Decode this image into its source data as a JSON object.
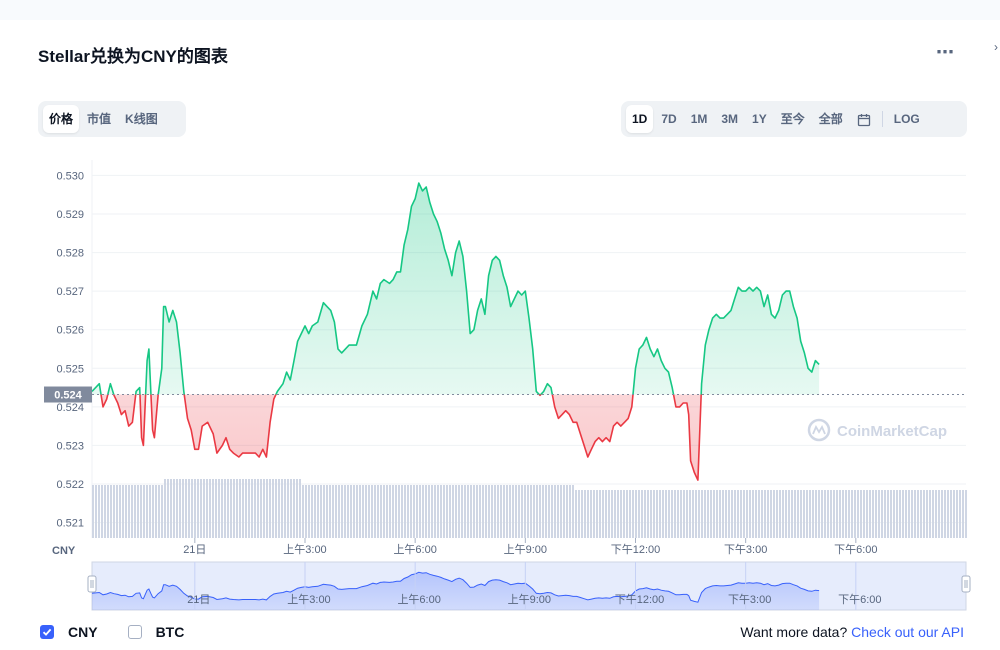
{
  "title": "Stellar兑换为CNY的图表",
  "more_icon": "⋯",
  "view_tabs": [
    "价格",
    "市值",
    "K线图"
  ],
  "active_view": 0,
  "range_tabs": [
    "1D",
    "7D",
    "1M",
    "3M",
    "1Y",
    "至今",
    "全部"
  ],
  "active_range": 0,
  "calendar_icon": "calendar-icon",
  "log_label": "LOG",
  "legend": {
    "cny_label": "CNY",
    "btc_label": "BTC",
    "cny_checked": true,
    "btc_checked": false
  },
  "api_text": "Want more data?",
  "api_link": "Check out our API",
  "watermark": "CoinMarketCap",
  "colors": {
    "up": "#16c784",
    "down": "#ea3943",
    "accent": "#3861fb",
    "volume": "#cfd6e4"
  },
  "chart_data": {
    "type": "area",
    "currency_label": "CNY",
    "baseline": 0.52432,
    "baseline_label": "0.524",
    "y_ticks": [
      "0.530",
      "0.529",
      "0.528",
      "0.527",
      "0.526",
      "0.525",
      "0.524",
      "0.523",
      "0.522",
      "0.521"
    ],
    "ylim": [
      0.5206,
      0.5304
    ],
    "x_ticks": [
      "21日",
      "上午3:00",
      "上午6:00",
      "上午9:00",
      "下午12:00",
      "下午3:00",
      "下午6:00"
    ],
    "x_tick_hours": [
      0,
      3,
      6,
      9,
      12,
      15,
      18
    ],
    "xlim": [
      -2.8,
      21.0
    ],
    "series": [
      {
        "values": [
          [
            -2.8,
            0.5244
          ],
          [
            -2.6,
            0.5246
          ],
          [
            -2.5,
            0.524
          ],
          [
            -2.4,
            0.5242
          ],
          [
            -2.3,
            0.5246
          ],
          [
            -2.2,
            0.5243
          ],
          [
            -2.1,
            0.5241
          ],
          [
            -2.0,
            0.5238
          ],
          [
            -1.9,
            0.5239
          ],
          [
            -1.8,
            0.5235
          ],
          [
            -1.7,
            0.5236
          ],
          [
            -1.6,
            0.5244
          ],
          [
            -1.5,
            0.5245
          ],
          [
            -1.45,
            0.5232
          ],
          [
            -1.4,
            0.523
          ],
          [
            -1.3,
            0.5252
          ],
          [
            -1.25,
            0.5255
          ],
          [
            -1.2,
            0.5244
          ],
          [
            -1.15,
            0.5234
          ],
          [
            -1.1,
            0.5232
          ],
          [
            -1.0,
            0.5243
          ],
          [
            -0.9,
            0.525
          ],
          [
            -0.85,
            0.5266
          ],
          [
            -0.8,
            0.5266
          ],
          [
            -0.7,
            0.5262
          ],
          [
            -0.6,
            0.5265
          ],
          [
            -0.5,
            0.5262
          ],
          [
            -0.4,
            0.5254
          ],
          [
            -0.3,
            0.5244
          ],
          [
            -0.2,
            0.5237
          ],
          [
            -0.1,
            0.5234
          ],
          [
            0.0,
            0.5229
          ],
          [
            0.1,
            0.5229
          ],
          [
            0.2,
            0.5235
          ],
          [
            0.35,
            0.5236
          ],
          [
            0.5,
            0.5233
          ],
          [
            0.6,
            0.5228
          ],
          [
            0.75,
            0.523
          ],
          [
            0.85,
            0.5232
          ],
          [
            0.95,
            0.5229
          ],
          [
            1.05,
            0.5228
          ],
          [
            1.2,
            0.5227
          ],
          [
            1.3,
            0.5228
          ],
          [
            1.5,
            0.5228
          ],
          [
            1.65,
            0.5228
          ],
          [
            1.75,
            0.5227
          ],
          [
            1.85,
            0.5229
          ],
          [
            1.95,
            0.5227
          ],
          [
            2.05,
            0.5236
          ],
          [
            2.15,
            0.5242
          ],
          [
            2.25,
            0.5244
          ],
          [
            2.4,
            0.5246
          ],
          [
            2.5,
            0.5249
          ],
          [
            2.6,
            0.5247
          ],
          [
            2.7,
            0.5252
          ],
          [
            2.8,
            0.5257
          ],
          [
            2.9,
            0.5259
          ],
          [
            3.0,
            0.5261
          ],
          [
            3.1,
            0.5259
          ],
          [
            3.2,
            0.5261
          ],
          [
            3.35,
            0.5262
          ],
          [
            3.5,
            0.5267
          ],
          [
            3.6,
            0.5266
          ],
          [
            3.7,
            0.5265
          ],
          [
            3.8,
            0.5262
          ],
          [
            3.9,
            0.5255
          ],
          [
            4.0,
            0.5254
          ],
          [
            4.2,
            0.5256
          ],
          [
            4.4,
            0.5256
          ],
          [
            4.55,
            0.5261
          ],
          [
            4.7,
            0.5264
          ],
          [
            4.85,
            0.527
          ],
          [
            4.95,
            0.5268
          ],
          [
            5.05,
            0.5272
          ],
          [
            5.15,
            0.5273
          ],
          [
            5.3,
            0.5272
          ],
          [
            5.4,
            0.5273
          ],
          [
            5.5,
            0.5275
          ],
          [
            5.6,
            0.5275
          ],
          [
            5.7,
            0.5282
          ],
          [
            5.8,
            0.5286
          ],
          [
            5.9,
            0.5292
          ],
          [
            6.0,
            0.5294
          ],
          [
            6.1,
            0.5298
          ],
          [
            6.2,
            0.5296
          ],
          [
            6.3,
            0.5297
          ],
          [
            6.4,
            0.5293
          ],
          [
            6.5,
            0.529
          ],
          [
            6.6,
            0.5288
          ],
          [
            6.7,
            0.5285
          ],
          [
            6.8,
            0.5281
          ],
          [
            6.9,
            0.5278
          ],
          [
            7.0,
            0.5274
          ],
          [
            7.1,
            0.528
          ],
          [
            7.2,
            0.5283
          ],
          [
            7.3,
            0.5279
          ],
          [
            7.4,
            0.527
          ],
          [
            7.5,
            0.5259
          ],
          [
            7.6,
            0.526
          ],
          [
            7.7,
            0.5265
          ],
          [
            7.8,
            0.5268
          ],
          [
            7.9,
            0.5264
          ],
          [
            8.0,
            0.5274
          ],
          [
            8.1,
            0.5278
          ],
          [
            8.2,
            0.5279
          ],
          [
            8.3,
            0.5278
          ],
          [
            8.4,
            0.5274
          ],
          [
            8.5,
            0.5271
          ],
          [
            8.6,
            0.5266
          ],
          [
            8.7,
            0.5268
          ],
          [
            8.8,
            0.527
          ],
          [
            8.9,
            0.5269
          ],
          [
            9.0,
            0.527
          ],
          [
            9.1,
            0.5263
          ],
          [
            9.2,
            0.5255
          ],
          [
            9.3,
            0.5244
          ],
          [
            9.4,
            0.5243
          ],
          [
            9.5,
            0.5244
          ],
          [
            9.6,
            0.5246
          ],
          [
            9.7,
            0.5245
          ],
          [
            9.8,
            0.524
          ],
          [
            9.9,
            0.5237
          ],
          [
            10.0,
            0.5238
          ],
          [
            10.1,
            0.5239
          ],
          [
            10.2,
            0.5238
          ],
          [
            10.3,
            0.5236
          ],
          [
            10.4,
            0.5236
          ],
          [
            10.5,
            0.5233
          ],
          [
            10.6,
            0.523
          ],
          [
            10.7,
            0.5227
          ],
          [
            10.8,
            0.5229
          ],
          [
            10.9,
            0.5231
          ],
          [
            11.0,
            0.5232
          ],
          [
            11.1,
            0.5231
          ],
          [
            11.2,
            0.5232
          ],
          [
            11.3,
            0.5231
          ],
          [
            11.4,
            0.5235
          ],
          [
            11.5,
            0.5236
          ],
          [
            11.6,
            0.5235
          ],
          [
            11.7,
            0.5236
          ],
          [
            11.8,
            0.5237
          ],
          [
            11.9,
            0.524
          ],
          [
            12.0,
            0.525
          ],
          [
            12.1,
            0.5255
          ],
          [
            12.2,
            0.5256
          ],
          [
            12.3,
            0.5258
          ],
          [
            12.4,
            0.5255
          ],
          [
            12.5,
            0.5253
          ],
          [
            12.6,
            0.5255
          ],
          [
            12.7,
            0.5252
          ],
          [
            12.8,
            0.525
          ],
          [
            12.9,
            0.5249
          ],
          [
            13.0,
            0.5245
          ],
          [
            13.1,
            0.524
          ],
          [
            13.2,
            0.524
          ],
          [
            13.3,
            0.5241
          ],
          [
            13.4,
            0.5241
          ],
          [
            13.45,
            0.5238
          ],
          [
            13.5,
            0.5226
          ],
          [
            13.6,
            0.5223
          ],
          [
            13.7,
            0.5221
          ],
          [
            13.8,
            0.5246
          ],
          [
            13.9,
            0.5256
          ],
          [
            14.0,
            0.526
          ],
          [
            14.1,
            0.5263
          ],
          [
            14.2,
            0.5264
          ],
          [
            14.3,
            0.5263
          ],
          [
            14.4,
            0.5263
          ],
          [
            14.5,
            0.5264
          ],
          [
            14.6,
            0.5265
          ],
          [
            14.7,
            0.5268
          ],
          [
            14.8,
            0.5271
          ],
          [
            14.9,
            0.527
          ],
          [
            15.0,
            0.527
          ],
          [
            15.1,
            0.5271
          ],
          [
            15.2,
            0.527
          ],
          [
            15.3,
            0.5271
          ],
          [
            15.4,
            0.527
          ],
          [
            15.5,
            0.5266
          ],
          [
            15.6,
            0.5269
          ],
          [
            15.7,
            0.5264
          ],
          [
            15.8,
            0.5263
          ],
          [
            15.9,
            0.5265
          ],
          [
            16.0,
            0.5269
          ],
          [
            16.1,
            0.527
          ],
          [
            16.2,
            0.527
          ],
          [
            16.3,
            0.5266
          ],
          [
            16.4,
            0.5263
          ],
          [
            16.5,
            0.5257
          ],
          [
            16.6,
            0.5254
          ],
          [
            16.7,
            0.525
          ],
          [
            16.8,
            0.5249
          ],
          [
            16.9,
            0.5252
          ],
          [
            17.0,
            0.5251
          ]
        ]
      }
    ]
  }
}
